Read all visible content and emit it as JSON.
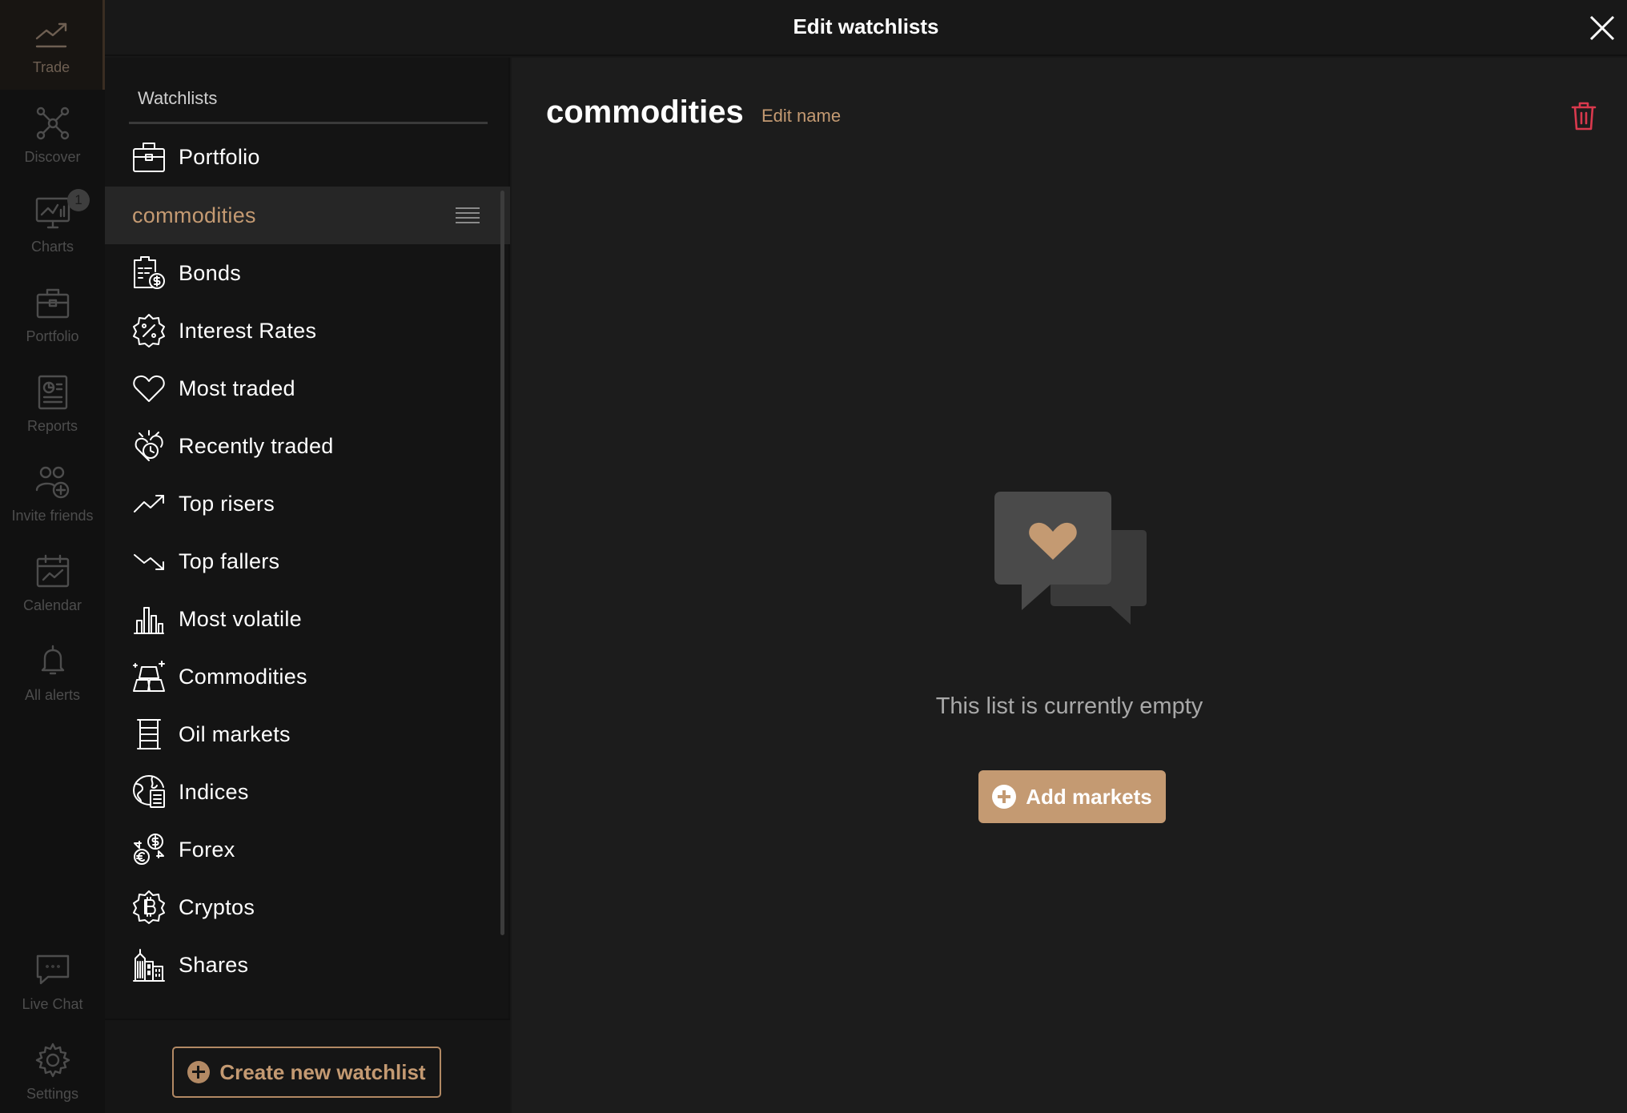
{
  "app_nav": {
    "items": [
      {
        "label": "Trade",
        "icon": "trend-up-icon",
        "active": true
      },
      {
        "label": "Discover",
        "icon": "network-icon"
      },
      {
        "label": "Charts",
        "icon": "chart-monitor-icon",
        "badge": "1"
      },
      {
        "label": "Portfolio",
        "icon": "briefcase-icon"
      },
      {
        "label": "Reports",
        "icon": "report-icon"
      },
      {
        "label": "Invite friends",
        "icon": "add-users-icon"
      },
      {
        "label": "Calendar",
        "icon": "calendar-icon"
      },
      {
        "label": "All alerts",
        "icon": "bell-icon"
      },
      {
        "label": "Live Chat",
        "icon": "chat-icon"
      },
      {
        "label": "Settings",
        "icon": "gear-icon"
      }
    ]
  },
  "modal": {
    "title": "Edit watchlists"
  },
  "watchlists": {
    "heading": "Watchlists",
    "items": [
      {
        "label": "Portfolio",
        "icon": "briefcase-icon"
      },
      {
        "label": "commodities",
        "selected": true
      },
      {
        "label": "Bonds",
        "icon": "bonds-icon"
      },
      {
        "label": "Interest Rates",
        "icon": "percent-badge-icon"
      },
      {
        "label": "Most traded",
        "icon": "heart-icon"
      },
      {
        "label": "Recently traded",
        "icon": "recent-clock-icon"
      },
      {
        "label": "Top risers",
        "icon": "trend-up-icon"
      },
      {
        "label": "Top fallers",
        "icon": "trend-down-icon"
      },
      {
        "label": "Most volatile",
        "icon": "bar-chart-icon"
      },
      {
        "label": "Commodities",
        "icon": "gold-bars-icon"
      },
      {
        "label": "Oil markets",
        "icon": "oil-barrel-icon"
      },
      {
        "label": "Indices",
        "icon": "globe-document-icon"
      },
      {
        "label": "Forex",
        "icon": "currency-exchange-icon"
      },
      {
        "label": "Cryptos",
        "icon": "bitcoin-icon"
      },
      {
        "label": "Shares",
        "icon": "buildings-icon"
      }
    ],
    "create_label": "Create new watchlist"
  },
  "main": {
    "list_title": "commodities",
    "edit_name_label": "Edit name",
    "empty_text": "This list is currently empty",
    "add_markets_label": "Add markets"
  },
  "colors": {
    "accent": "#c49a72",
    "delete": "#d9394d",
    "background": "#1c1c1c"
  }
}
